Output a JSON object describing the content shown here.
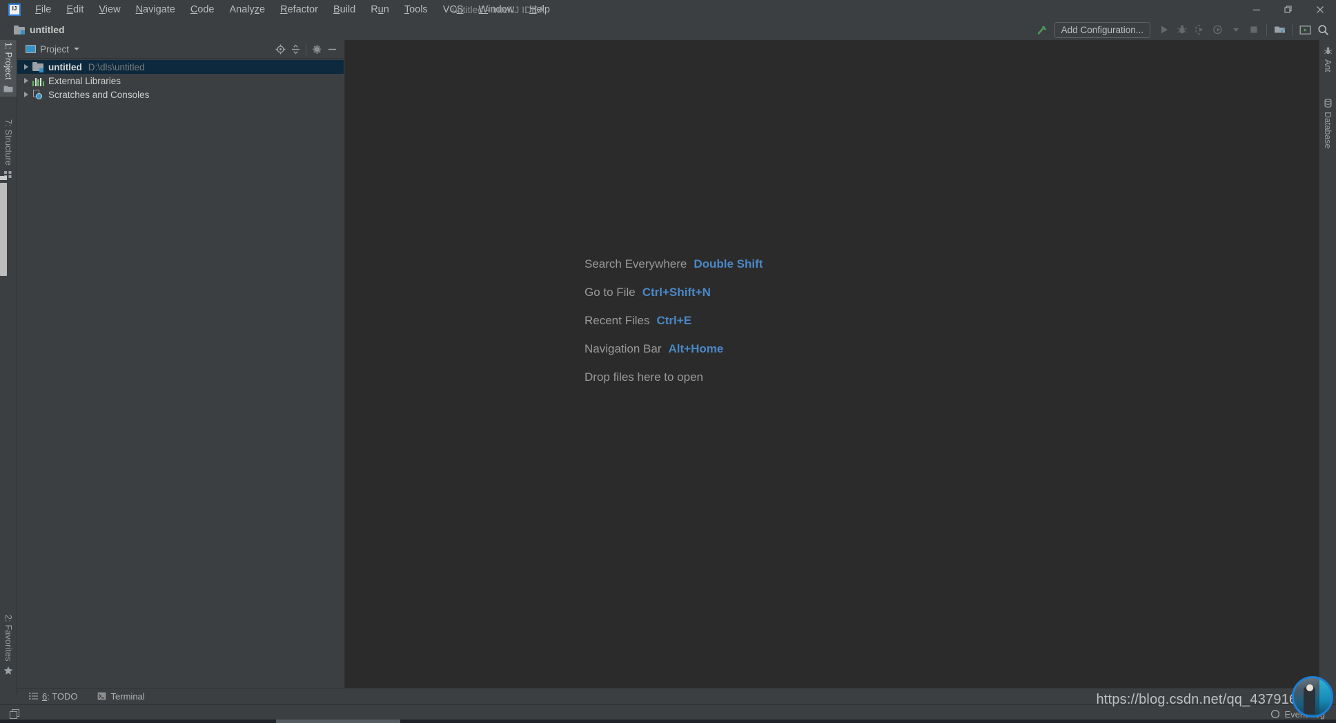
{
  "window": {
    "title": "untitled - IntelliJ IDEA",
    "logo_icon": "intellij-idea-logo",
    "controls": [
      {
        "name": "minimize-button",
        "icon": "minimize-icon"
      },
      {
        "name": "restore-button",
        "icon": "restore-window-icon"
      },
      {
        "name": "close-button",
        "icon": "close-icon"
      }
    ]
  },
  "menubar": {
    "items": [
      {
        "label": "File",
        "mnemonic": "F"
      },
      {
        "label": "Edit",
        "mnemonic": "E"
      },
      {
        "label": "View",
        "mnemonic": "V"
      },
      {
        "label": "Navigate",
        "mnemonic": "N"
      },
      {
        "label": "Code",
        "mnemonic": "C"
      },
      {
        "label": "Analyze",
        "mnemonic": "z"
      },
      {
        "label": "Refactor",
        "mnemonic": "R"
      },
      {
        "label": "Build",
        "mnemonic": "B"
      },
      {
        "label": "Run",
        "mnemonic": "u"
      },
      {
        "label": "Tools",
        "mnemonic": "T"
      },
      {
        "label": "VCS",
        "mnemonic": "S"
      },
      {
        "label": "Window",
        "mnemonic": "W"
      },
      {
        "label": "Help",
        "mnemonic": "H"
      }
    ]
  },
  "navbar": {
    "breadcrumb": "untitled",
    "breadcrumb_icon": "project-folder-icon",
    "toolbar": {
      "build_icon": "build-hammer-icon",
      "add_configuration_label": "Add Configuration...",
      "run_icon": "run-icon",
      "debug_icon": "debug-bug-icon",
      "run_with_coverage_icon": "run-with-coverage-icon",
      "profile_icon": "profiler-icon",
      "profile_dropdown_icon": "chevron-down-icon",
      "stop_icon": "stop-icon",
      "project_structure_icon": "project-structure-icon",
      "updates_icon": "run-anything-icon",
      "search_icon": "search-icon"
    }
  },
  "left_stripe": {
    "tabs": [
      {
        "label": "1: Project",
        "icon": "project-folder-icon",
        "active": true
      },
      {
        "label": "7: Structure",
        "icon": "structure-icon",
        "active": false
      },
      {
        "label": "2: Favorites",
        "icon": "star-icon",
        "active": false
      }
    ]
  },
  "right_stripe": {
    "tabs": [
      {
        "label": "Ant",
        "icon": "ant-icon"
      },
      {
        "label": "Database",
        "icon": "database-icon"
      }
    ]
  },
  "project_panel": {
    "title": "Project",
    "title_icon": "project-window-icon",
    "dropdown_icon": "chevron-down-icon",
    "actions": [
      {
        "name": "select-opened-file-button",
        "icon": "locate-target-icon"
      },
      {
        "name": "collapse-all-button",
        "icon": "collapse-all-icon"
      },
      {
        "name": "settings-button",
        "icon": "gear-icon"
      },
      {
        "name": "hide-button",
        "icon": "minimize-icon"
      }
    ],
    "tree": [
      {
        "label": "untitled",
        "path": "D:\\dls\\untitled",
        "icon": "project-folder-icon",
        "bold": true,
        "selected": true,
        "expanded": false
      },
      {
        "label": "External Libraries",
        "path": "",
        "icon": "external-libraries-icon",
        "bold": false,
        "selected": false,
        "expanded": false
      },
      {
        "label": "Scratches and Consoles",
        "path": "",
        "icon": "scratches-icon",
        "bold": false,
        "selected": false,
        "expanded": false
      }
    ]
  },
  "editor": {
    "hints": [
      {
        "label": "Search Everywhere",
        "shortcut": "Double Shift"
      },
      {
        "label": "Go to File",
        "shortcut": "Ctrl+Shift+N"
      },
      {
        "label": "Recent Files",
        "shortcut": "Ctrl+E"
      },
      {
        "label": "Navigation Bar",
        "shortcut": "Alt+Home"
      },
      {
        "label": "Drop files here to open",
        "shortcut": ""
      }
    ]
  },
  "bottom_bar": {
    "tabs": [
      {
        "label_prefix": "6",
        "label": ": TODO",
        "icon": "todo-list-icon"
      },
      {
        "label_prefix": "",
        "label": "Terminal",
        "icon": "terminal-icon"
      }
    ]
  },
  "status_bar": {
    "layout_icon": "layout-toggle-icon",
    "event_log_label": "Event Log",
    "event_log_icon": "event-log-icon"
  },
  "overlay": {
    "watermark": "https://blog.csdn.net/qq_43791614",
    "avatar_name": "webcam-avatar"
  },
  "colors": {
    "panel_bg": "#3c3f41",
    "editor_bg": "#2b2b2b",
    "selection": "#0d293e",
    "accent_blue": "#3592c4",
    "hint_key": "#4a88c7",
    "text": "#bbbbbb",
    "muted_text": "#7d7d7d",
    "build_green": "#499c54"
  }
}
